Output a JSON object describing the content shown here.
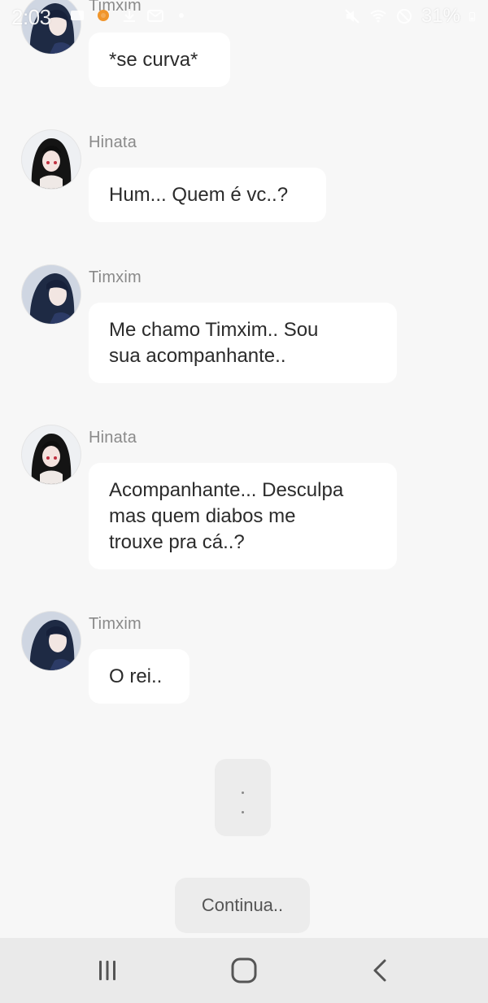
{
  "status_bar": {
    "time": "2:03",
    "battery": "31%"
  },
  "messages": [
    {
      "sender": "Timxim",
      "text": "*se curva*",
      "avatar": "avatar-timxim"
    },
    {
      "sender": "Hinata",
      "text": "Hum... Quem é vc..?",
      "avatar": "avatar-hinata"
    },
    {
      "sender": "Timxim",
      "line1": "Me chamo Timxim.. Sou",
      "line2": "sua acompanhante..",
      "avatar": "avatar-timxim"
    },
    {
      "sender": "Hinata",
      "line1": "Acompanhante... Desculpa",
      "line2": "mas quem diabos me",
      "line3": "trouxe pra cá..?",
      "avatar": "avatar-hinata"
    },
    {
      "sender": "Timxim",
      "text": "O rei..",
      "avatar": "avatar-timxim"
    }
  ],
  "continue_button": {
    "label": "Continua.."
  },
  "nav_bar": {
    "icons": [
      "recent-apps-icon",
      "home-icon",
      "back-icon"
    ]
  },
  "colors": {
    "background": "#f7f7f7",
    "bubble": "#ffffff",
    "text": "#2b2b2b",
    "sender_name": "#8a8a8a",
    "button": "#ececec",
    "nav_bar": "#eaeaea"
  }
}
